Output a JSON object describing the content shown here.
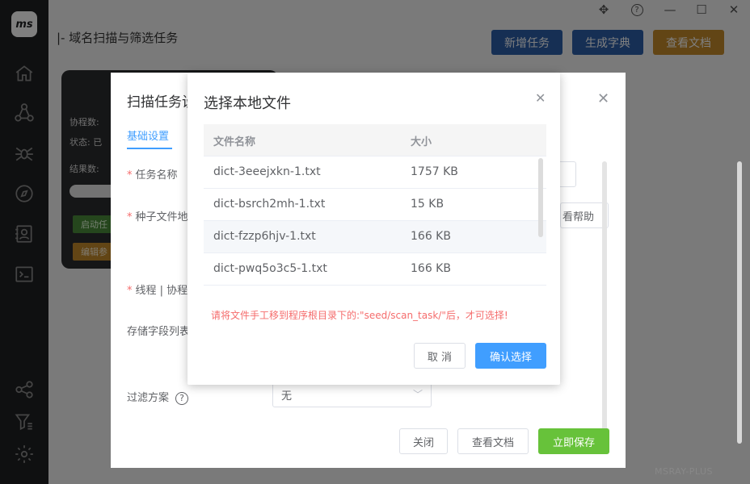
{
  "app": {
    "logo_text": "ms",
    "watermark": "MSRAY-PLUS"
  },
  "sidebar": {
    "icons": [
      "home-icon",
      "network-icon",
      "spider-icon",
      "compass-icon",
      "contacts-icon",
      "terminal-icon",
      "nodes-icon",
      "filter-icon",
      "settings-icon"
    ]
  },
  "window_controls": {
    "move": "✥",
    "help": "?",
    "minimize": "—",
    "maximize": "☐",
    "close": "✕"
  },
  "header": {
    "title": "|- 域名扫描与筛选任务",
    "buttons": [
      {
        "label": "新增任务",
        "color": "#2d5fa8"
      },
      {
        "label": "生成字典",
        "color": "#2d5fa8"
      },
      {
        "label": "查看文档",
        "color": "#c48a2b"
      }
    ]
  },
  "task_card": {
    "line1": "协程数: ",
    "line2": "状态: 已",
    "line3": "结果数: ",
    "start_button": "启动任",
    "edit_button": "编辑参"
  },
  "task_dialog": {
    "title": "扫描任务设",
    "tab": "基础设置",
    "labels": {
      "task_name": "任务名称",
      "seed_file": "种子文件地",
      "threads": "线程 | 协程",
      "storage_fields": "存储字段列表",
      "filter_plan": "过滤方案"
    },
    "help_button": "看帮助",
    "filter_value": "无",
    "buttons": {
      "close": "关闭",
      "docs": "查看文档",
      "save": "立即保存"
    }
  },
  "file_dialog": {
    "title": "选择本地文件",
    "columns": {
      "name": "文件名称",
      "size": "大小"
    },
    "rows": [
      {
        "name": "dict-3eeejxkn-1.txt",
        "size": "1757 KB"
      },
      {
        "name": "dict-bsrch2mh-1.txt",
        "size": "15 KB"
      },
      {
        "name": "dict-fzzp6hjv-1.txt",
        "size": "166 KB"
      },
      {
        "name": "dict-pwq5o3c5-1.txt",
        "size": "166 KB"
      }
    ],
    "hint": "请将文件手工移到程序根目录下的:\"seed/scan_task/\"后，才可选择!",
    "cancel_label": "取 消",
    "ok_label": "确认选择"
  }
}
